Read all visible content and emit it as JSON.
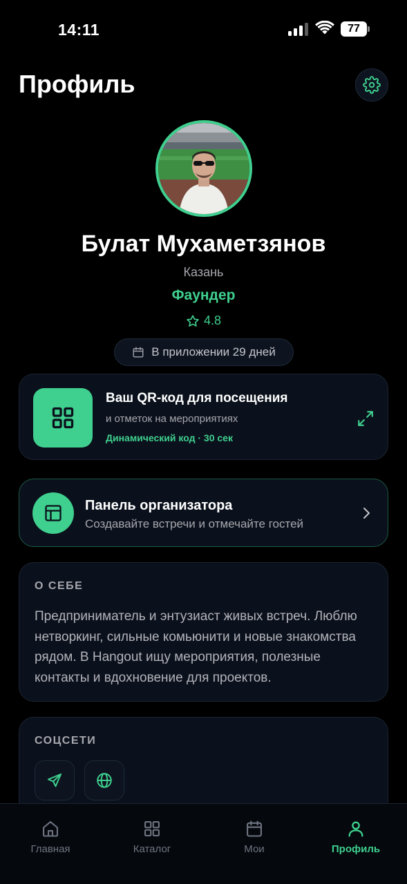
{
  "status_bar": {
    "time": "14:11",
    "battery": "77"
  },
  "header": {
    "title": "Профиль",
    "settings_icon": "gear-icon"
  },
  "profile": {
    "name": "Булат Мухаметзянов",
    "city": "Казань",
    "role": "Фаундер",
    "rating": "4.8",
    "days_in_app": "В приложении 29 дней"
  },
  "qr_card": {
    "title": "Ваш QR-код для посещения",
    "subtitle": "и отметок на мероприятиях",
    "dynamic_note": "Динамический код · 30 сек"
  },
  "organizer_card": {
    "title": "Панель организатора",
    "subtitle": "Создавайте встречи и отмечайте гостей"
  },
  "about": {
    "label": "О СЕБЕ",
    "text": "Предприниматель и энтузиаст живых встреч. Люблю нетворкинг, сильные комьюнити и новые знакомства рядом. В Hangout ищу мероприятия, полезные контакты и вдохновение для проектов."
  },
  "socials": {
    "label": "СОЦСЕТИ",
    "items": [
      {
        "icon": "telegram-send-icon"
      },
      {
        "icon": "globe-icon"
      }
    ]
  },
  "tabbar": {
    "items": [
      {
        "label": "Главная",
        "icon": "home-icon",
        "active": false
      },
      {
        "label": "Каталог",
        "icon": "grid-icon",
        "active": false
      },
      {
        "label": "Мои",
        "icon": "calendar-icon",
        "active": false
      },
      {
        "label": "Профиль",
        "icon": "user-icon",
        "active": true
      }
    ]
  },
  "colors": {
    "accent": "#3fcf8e",
    "background": "#000000",
    "card": "#0b111c",
    "muted_text": "#a7a7ae"
  }
}
